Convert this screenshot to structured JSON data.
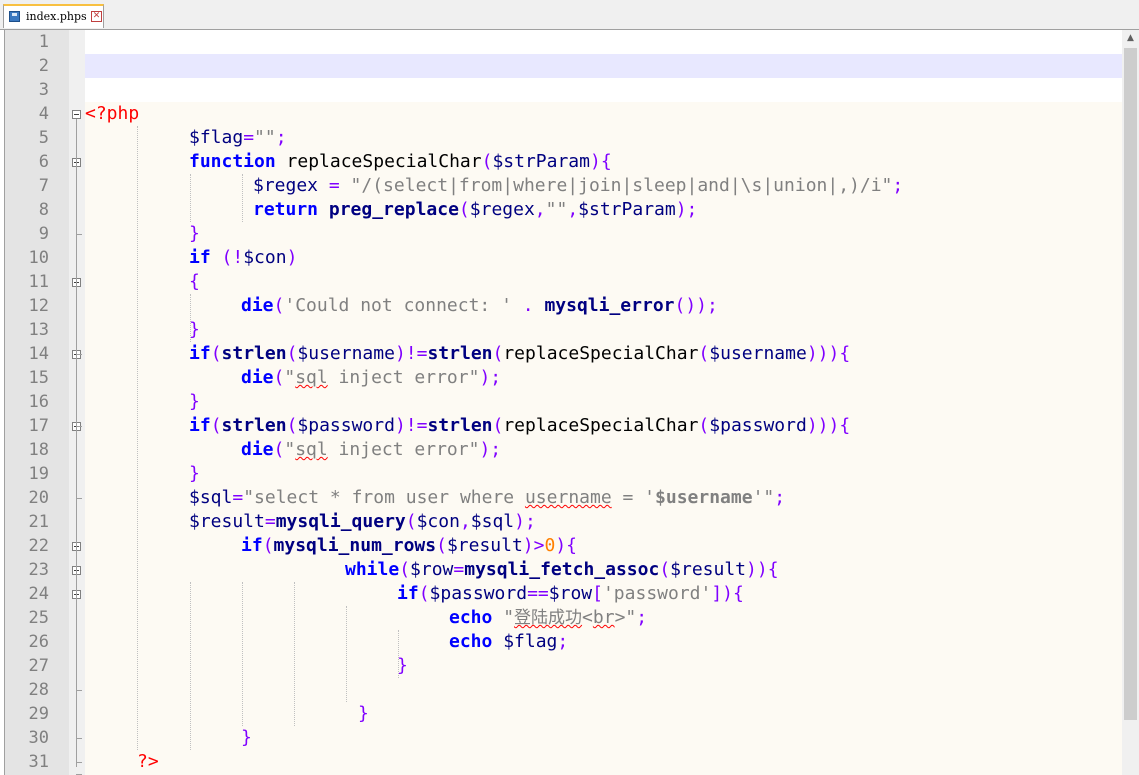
{
  "tab": {
    "title": "index.phps",
    "close": "✕",
    "icon": "php-file-icon"
  },
  "colors": {
    "keyword": "#0000ff",
    "function": "#000080",
    "string": "#808080",
    "punctuation": "#8000ff",
    "php_tag": "#ff0000",
    "number": "#ff8000",
    "gutter": "#e4e4e4",
    "code_background": "#fdfaf3",
    "current_line": "#e8e8ff"
  },
  "editor": {
    "line_numbers": [
      "1",
      "2",
      "3",
      "4",
      "5",
      "6",
      "7",
      "8",
      "9",
      "10",
      "11",
      "12",
      "13",
      "14",
      "15",
      "16",
      "17",
      "18",
      "19",
      "20",
      "21",
      "22",
      "23",
      "24",
      "25",
      "26",
      "27",
      "28",
      "29",
      "30",
      "31"
    ],
    "tokens": {
      "l4": [
        "<?php"
      ],
      "l5": [
        "$flag",
        "=",
        "\"\"",
        ";"
      ],
      "l6": [
        "function",
        " replaceSpecialChar",
        "(",
        "$strParam",
        "){"
      ],
      "l7": [
        "$regex",
        " = ",
        "\"/(select|from|where|join|sleep|and|\\s|union|,)/i\"",
        ";"
      ],
      "l8": [
        "return",
        " ",
        "preg_replace",
        "(",
        "$regex",
        ",",
        "\"\"",
        ",",
        "$strParam",
        ");"
      ],
      "l9": [
        "}"
      ],
      "l10": [
        "if",
        " (!",
        "$con",
        ")"
      ],
      "l11": [
        "{"
      ],
      "l12": [
        "die",
        "(",
        "'Could not connect: '",
        " . ",
        "mysqli_error",
        "());"
      ],
      "l13": [
        "}"
      ],
      "l14": [
        "if",
        "(",
        "strlen",
        "(",
        "$username",
        ")!=",
        "strlen",
        "(",
        "replaceSpecialChar",
        "(",
        "$username",
        "))){"
      ],
      "l15": [
        "die",
        "(",
        "\"",
        "sql",
        " inject error\"",
        ");"
      ],
      "l16": [
        "}"
      ],
      "l17": [
        "if",
        "(",
        "strlen",
        "(",
        "$password",
        ")!=",
        "strlen",
        "(",
        "replaceSpecialChar",
        "(",
        "$password",
        "))){"
      ],
      "l18": [
        "die",
        "(",
        "\"",
        "sql",
        " inject error\"",
        ");"
      ],
      "l19": [
        "}"
      ],
      "l20": [
        "$sql",
        "=",
        "\"select * from user where ",
        "username",
        " = '",
        "$username",
        "'\"",
        ";"
      ],
      "l21": [
        "$result",
        "=",
        "mysqli_query",
        "(",
        "$con",
        ",",
        "$sql",
        ");"
      ],
      "l22": [
        "if",
        "(",
        "mysqli_num_rows",
        "(",
        "$result",
        ")>",
        "0",
        "){"
      ],
      "l23": [
        "while",
        "(",
        "$row",
        "=",
        "mysqli_fetch_assoc",
        "(",
        "$result",
        ")){"
      ],
      "l24": [
        "if",
        "(",
        "$password",
        "==",
        "$row",
        "[",
        "'password'",
        "]){"
      ],
      "l25": [
        "echo",
        " \"",
        "登陆成功",
        "<",
        "br",
        ">\"",
        ";"
      ],
      "l26": [
        "echo",
        " ",
        "$flag",
        ";"
      ],
      "l27": [
        "}"
      ],
      "l29": [
        "}"
      ],
      "l30": [
        "}"
      ],
      "l31": [
        "?>"
      ]
    }
  }
}
